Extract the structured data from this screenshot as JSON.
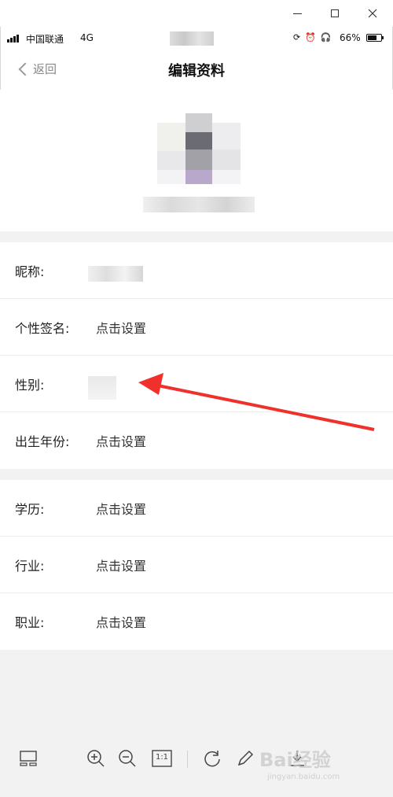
{
  "window": {
    "minimize_icon": "minimize-icon",
    "maximize_icon": "maximize-icon",
    "close_icon": "close-icon"
  },
  "status_bar": {
    "carrier": "中国联通",
    "network": "4G",
    "battery": "66%",
    "icons": [
      "rotation-lock-icon",
      "alarm-icon",
      "headphones-icon"
    ]
  },
  "nav": {
    "back_label": "返回",
    "title": "编辑资料"
  },
  "profile_rows": [
    {
      "label": "昵称:",
      "value": ""
    },
    {
      "label": "个性签名:",
      "value": "点击设置"
    },
    {
      "label": "性别:",
      "value": ""
    },
    {
      "label": "出生年份:",
      "value": "点击设置"
    }
  ],
  "career_rows": [
    {
      "label": "学历:",
      "value": "点击设置"
    },
    {
      "label": "行业:",
      "value": "点击设置"
    },
    {
      "label": "职业:",
      "value": "点击设置"
    }
  ],
  "toolbar": {
    "items": [
      "thumbnail-icon",
      "zoom-in-icon",
      "zoom-out-icon",
      "actual-size-icon",
      "rotate-icon",
      "edit-icon",
      "download-icon"
    ],
    "actual_size_label": "1:1"
  },
  "colors": {
    "accent_arrow": "#f0302a",
    "section_gap": "#f2f2f2",
    "divider": "#ececec"
  },
  "watermark": {
    "text": "Bai经验",
    "url": "jingyan.baidu.com"
  }
}
